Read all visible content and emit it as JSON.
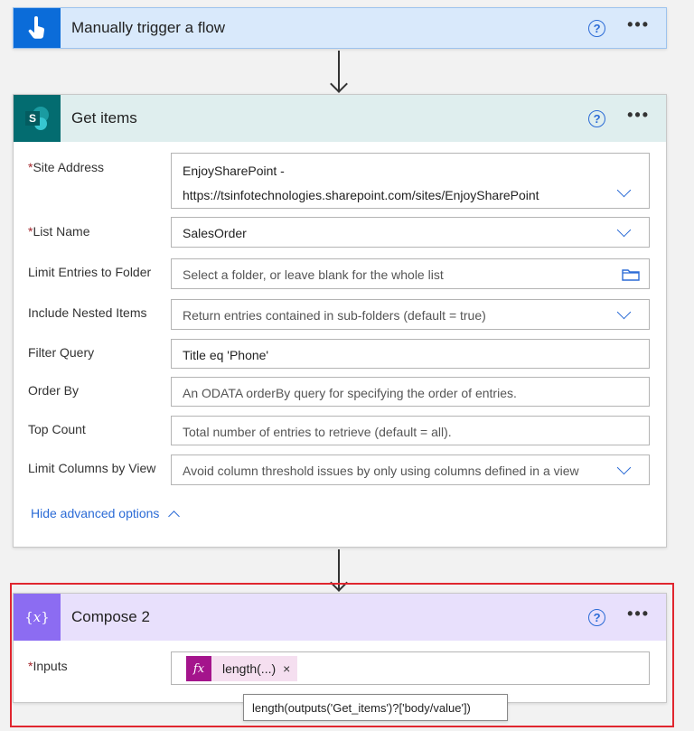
{
  "colors": {
    "trigger_accent": "#0b6cd9",
    "sharepoint_accent": "#036c70",
    "compose_accent": "#8c6cf2",
    "link": "#2b6bd6",
    "highlight": "#e0262f"
  },
  "trigger": {
    "title": "Manually trigger a flow",
    "icon": "hand-touch-icon",
    "help": "?",
    "more": "•••"
  },
  "get_items": {
    "title": "Get items",
    "icon": "sharepoint-icon",
    "icon_letter": "S",
    "help": "?",
    "more": "•••",
    "fields": {
      "site_address": {
        "label": "Site Address",
        "required": "*",
        "value_line1": "EnjoySharePoint -",
        "value_line2": "https://tsinfotechnologies.sharepoint.com/sites/EnjoySharePoint"
      },
      "list_name": {
        "label": "List Name",
        "required": "*",
        "value": "SalesOrder"
      },
      "limit_folder": {
        "label": "Limit Entries to Folder",
        "placeholder": "Select a folder, or leave blank for the whole list"
      },
      "nested_items": {
        "label": "Include Nested Items",
        "placeholder": "Return entries contained in sub-folders (default = true)"
      },
      "filter_query": {
        "label": "Filter Query",
        "value": "Title eq 'Phone'"
      },
      "order_by": {
        "label": "Order By",
        "placeholder": "An ODATA orderBy query for specifying the order of entries."
      },
      "top_count": {
        "label": "Top Count",
        "placeholder": "Total number of entries to retrieve (default = all)."
      },
      "limit_columns": {
        "label": "Limit Columns by View",
        "placeholder": "Avoid column threshold issues by only using columns defined in a view"
      }
    },
    "advanced_link": "Hide advanced options"
  },
  "compose": {
    "title": "Compose 2",
    "icon": "curly-braces-icon",
    "icon_glyph": "{𝑥}",
    "help": "?",
    "more": "•••",
    "inputs_label": "Inputs",
    "required": "*",
    "token_fx": "fx",
    "token_text": "length(...)",
    "token_remove": "×",
    "tooltip": "length(outputs('Get_items')?['body/value'])"
  }
}
